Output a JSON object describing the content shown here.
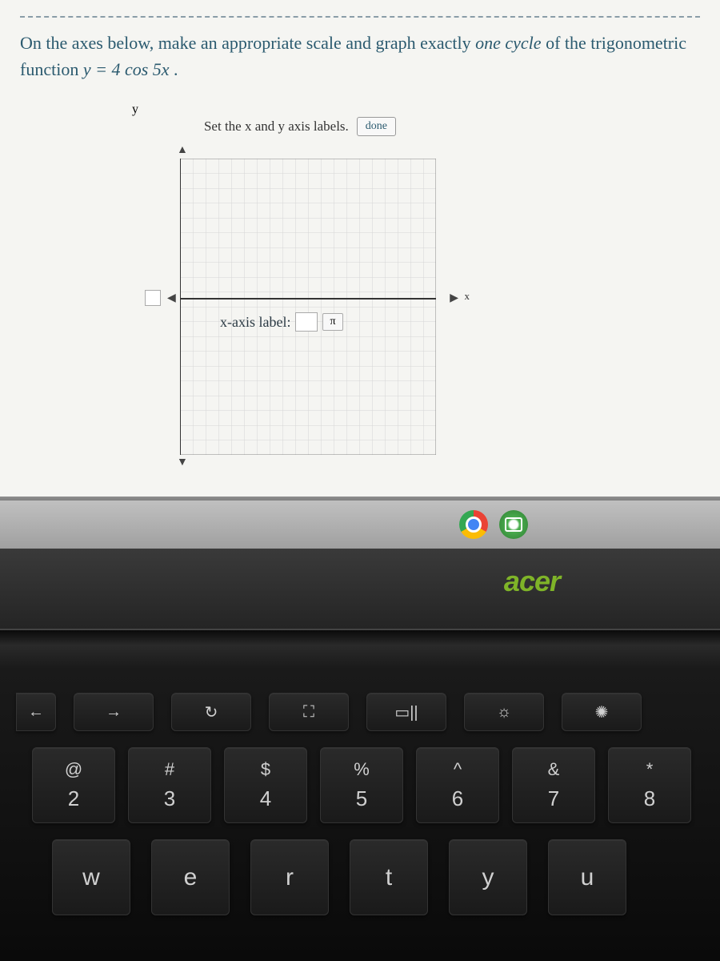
{
  "question": {
    "prefix": "On the axes below, make an appropriate scale and graph exactly ",
    "emphasis": "one cycle",
    "middle": " of the trigonometric function ",
    "equation_lhs": "y",
    "equation_eq": " = ",
    "equation_rhs": "4 cos 5x",
    "equation_period": "."
  },
  "graph": {
    "y_axis_char": "y",
    "x_axis_char": "x",
    "instruction": "Set the x and y axis labels.",
    "done_label": "done",
    "x_label_prompt": "x-axis label:",
    "pi_symbol": "π",
    "x_input_value": "",
    "y_tick_value": ""
  },
  "laptop": {
    "brand": "acer"
  },
  "keyboard": {
    "fn_row": [
      {
        "name": "back",
        "glyph": "←"
      },
      {
        "name": "forward",
        "glyph": "→"
      },
      {
        "name": "refresh",
        "glyph": "↻"
      },
      {
        "name": "fullscreen",
        "glyph": "⛶"
      },
      {
        "name": "overview",
        "glyph": "▭||"
      },
      {
        "name": "brightness-down",
        "glyph": "☼"
      },
      {
        "name": "brightness-up",
        "glyph": "✺"
      }
    ],
    "num_row": [
      {
        "sym": "@",
        "dig": "2"
      },
      {
        "sym": "#",
        "dig": "3"
      },
      {
        "sym": "$",
        "dig": "4"
      },
      {
        "sym": "%",
        "dig": "5"
      },
      {
        "sym": "^",
        "dig": "6"
      },
      {
        "sym": "&",
        "dig": "7"
      },
      {
        "sym": "*",
        "dig": "8"
      }
    ],
    "qwerty_row": [
      "w",
      "e",
      "r",
      "t",
      "y",
      "u"
    ]
  }
}
